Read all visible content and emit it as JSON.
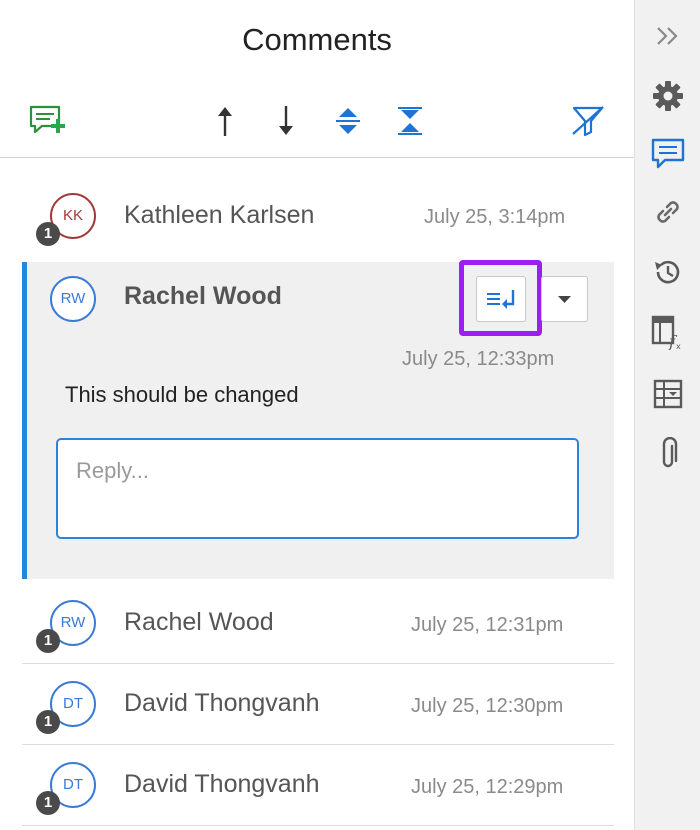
{
  "panel": {
    "title": "Comments"
  },
  "toolbar": {
    "icons": [
      "add-comment-icon",
      "arrow-up-icon",
      "arrow-down-icon",
      "expand-all-icon",
      "collapse-all-icon",
      "filter-off-icon"
    ]
  },
  "comments": [
    {
      "initials": "KK",
      "name": "Kathleen Karlsen",
      "time": "July 25, 3:14pm",
      "replies": "1",
      "avatar_color": "#a33a3a"
    },
    {
      "initials": "RW",
      "name": "Rachel Wood",
      "time": "July 25, 12:33pm",
      "body": "This should be changed",
      "avatar_color": "#3a7bd5",
      "active": true
    },
    {
      "initials": "RW",
      "name": "Rachel Wood",
      "time": "July 25, 12:31pm",
      "replies": "1",
      "avatar_color": "#3a7bd5"
    },
    {
      "initials": "DT",
      "name": "David Thongvanh",
      "time": "July 25, 12:30pm",
      "replies": "1",
      "avatar_color": "#3a7bd5"
    },
    {
      "initials": "DT",
      "name": "David Thongvanh",
      "time": "July 25, 12:29pm",
      "replies": "1",
      "avatar_color": "#3a7bd5"
    }
  ],
  "reply": {
    "placeholder": "Reply..."
  },
  "sidebar": {
    "icons": [
      "collapse-panel-icon",
      "settings-icon",
      "comments-icon",
      "link-icon",
      "history-icon",
      "formula-icon",
      "table-icon",
      "attachment-icon"
    ]
  },
  "colors": {
    "accent": "#1e88e5",
    "highlight": "#9b1ff0",
    "add_green": "#2da44e"
  }
}
